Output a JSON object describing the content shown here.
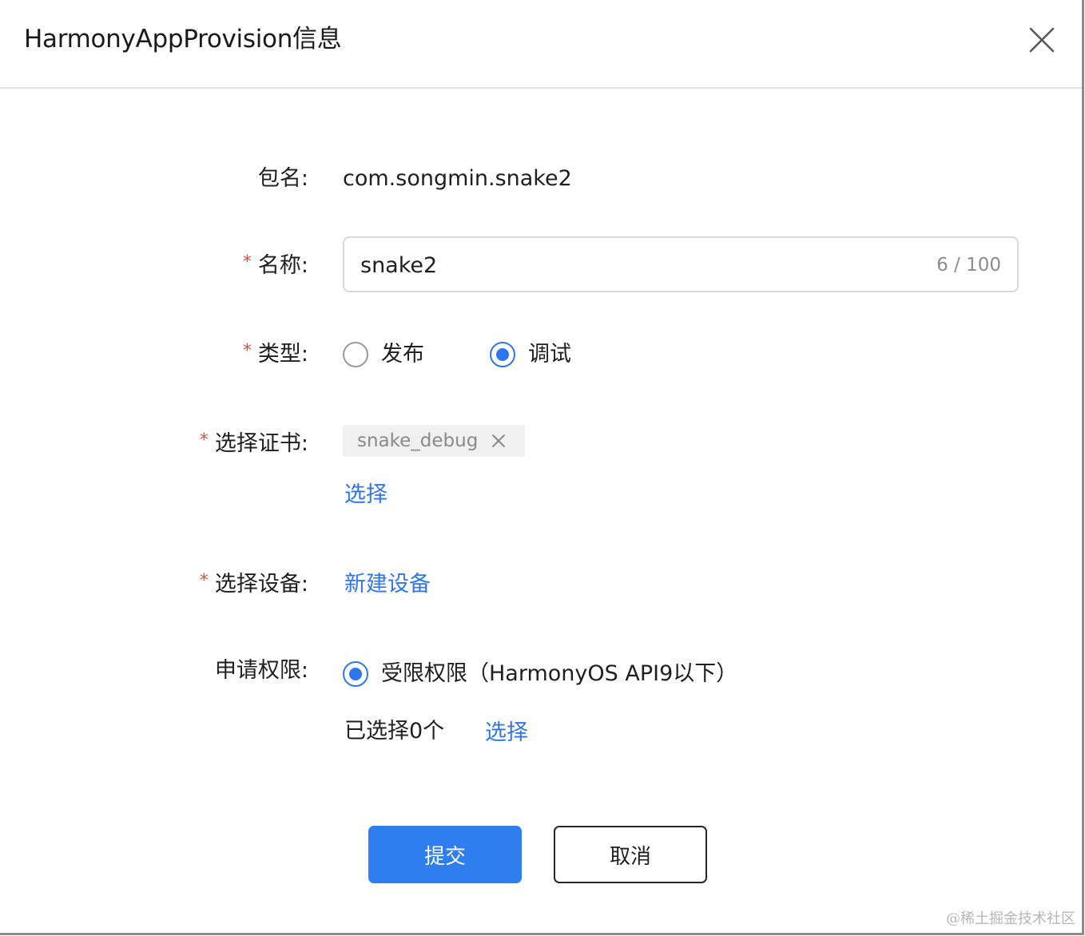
{
  "dialog": {
    "title": "HarmonyAppProvision信息",
    "close_icon": "close-icon"
  },
  "form": {
    "package": {
      "label": "包名:",
      "value": "com.songmin.snake2"
    },
    "name": {
      "required_mark": "*",
      "label": "名称:",
      "value": "snake2",
      "counter": "6 / 100"
    },
    "type": {
      "required_mark": "*",
      "label": "类型:",
      "options": [
        {
          "label": "发布",
          "checked": false
        },
        {
          "label": "调试",
          "checked": true
        }
      ]
    },
    "certificate": {
      "required_mark": "*",
      "label": "选择证书:",
      "selected_tag": "snake_debug",
      "select_link": "选择"
    },
    "device": {
      "required_mark": "*",
      "label": "选择设备:",
      "new_device_link": "新建设备"
    },
    "permissions": {
      "label": "申请权限:",
      "option": {
        "label": "受限权限（HarmonyOS API9以下）",
        "checked": true
      },
      "selected_count_text": "已选择0个",
      "select_link": "选择"
    }
  },
  "actions": {
    "submit_label": "提交",
    "cancel_label": "取消"
  },
  "watermark": "@稀土掘金技术社区",
  "colors": {
    "accent": "#2f76ee",
    "primary_button": "#2f7ef0",
    "required": "#e34d3b",
    "muted_text": "#8c8c8c"
  }
}
